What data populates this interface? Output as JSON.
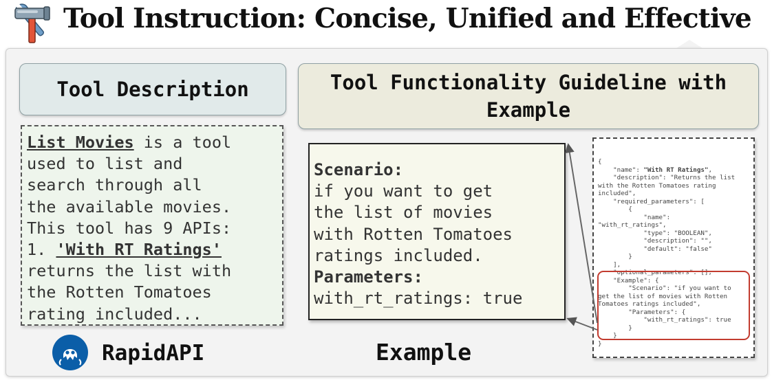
{
  "title": "Tool Instruction: Concise, Unified and Effective",
  "description": {
    "heading": "Tool Description",
    "tool_name": "List Movies",
    "intro": " is a tool\nused to list and\nsearch through all\nthe available movies.\nThis tool has 9 APIs:\n1. ",
    "api_name": "'With RT Ratings'",
    "tail": "\nreturns the list with\nthe Rotten Tomatoes\nrating included..."
  },
  "guideline": {
    "heading": "Tool Functionality Guideline with Example",
    "scenario_label": "Scenario:",
    "scenario_text": "if you want to get\nthe list of movies\nwith Rotten Tomatoes\nratings included.",
    "parameters_label": "Parameters:",
    "parameters_text": "with_rt_ratings: true"
  },
  "json": {
    "head": "{\n    \"name\": ",
    "name_value": "\"With RT Ratings\"",
    "body": ",\n    \"description\": \"Returns the list\nwith the Rotten Tomatoes rating\nincluded\",\n    \"required_parameters\": [\n        {\n            \"name\":\n\"with_rt_ratings\",\n            \"type\": \"BOOLEAN\",\n            \"description\": \"\",\n            \"default\": \"false\"\n        }\n    ],\n    \"optional_parameters\": [],\n    \"Example\": {\n        \"Scenario\": \"if you want to\nget the list of movies with Rotten\nTomatoes ratings included\",\n        \"Parameters\": {\n            \"with_rt_ratings\": true\n        }\n    }\n}"
  },
  "labels": {
    "rapidapi": "RapidAPI",
    "example": "Example"
  },
  "colors": {
    "description_heading_bg": "#e1eaea",
    "guideline_heading_bg": "#ecebdd",
    "description_box_bg": "#eef5ec",
    "example_box_bg": "#f7f8ec",
    "highlight_border": "#c23b2f",
    "rapidapi_logo": "#0b5ea8"
  },
  "icons": {
    "title": "hammer-wrench-icon",
    "logo": "rapidapi-logo-icon"
  }
}
